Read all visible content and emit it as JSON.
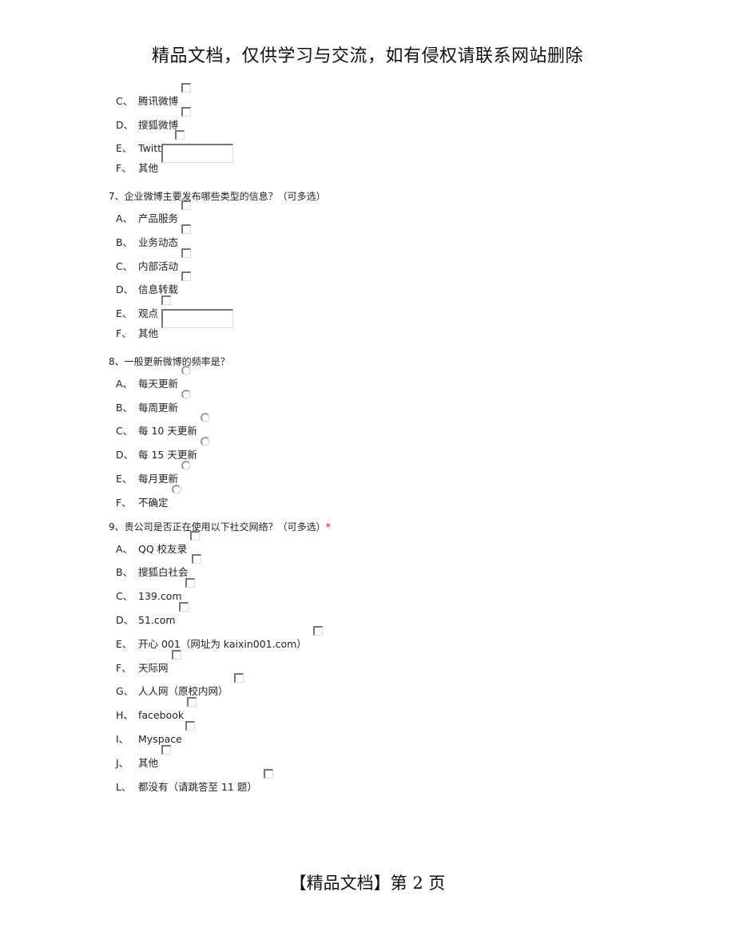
{
  "header": {
    "text": "精品文档，仅供学习与交流，如有侵权请联系网站删除"
  },
  "footer": {
    "text": "【精品文档】第 2 页"
  },
  "q6_tail": {
    "options": [
      {
        "letter": "C、",
        "label": "腾讯微博",
        "control": "checkbox"
      },
      {
        "letter": "D、",
        "label": "搜狐微博",
        "control": "checkbox"
      },
      {
        "letter": "E、",
        "label": "Twitter",
        "control": "checkbox"
      },
      {
        "letter": "F、",
        "label": "其他",
        "control": "text",
        "value": ""
      }
    ]
  },
  "q7": {
    "title": "7、企业微博主要发布哪些类型的信息？（可多选）",
    "options": [
      {
        "letter": "A、",
        "label": "产品服务",
        "control": "checkbox"
      },
      {
        "letter": "B、",
        "label": "业务动态",
        "control": "checkbox"
      },
      {
        "letter": "C、",
        "label": "内部活动",
        "control": "checkbox"
      },
      {
        "letter": "D、",
        "label": "信息转载",
        "control": "checkbox"
      },
      {
        "letter": "E、",
        "label": "观点",
        "control": "checkbox"
      },
      {
        "letter": "F、",
        "label": "其他",
        "control": "text",
        "value": ""
      }
    ]
  },
  "q8": {
    "title": "8、一般更新微博的频率是？",
    "options": [
      {
        "letter": "A、",
        "label": "每天更新",
        "control": "radio"
      },
      {
        "letter": "B、",
        "label": "每周更新",
        "control": "radio"
      },
      {
        "letter": "C、",
        "label": "每 10 天更新",
        "control": "radio"
      },
      {
        "letter": "D、",
        "label": "每 15 天更新",
        "control": "radio"
      },
      {
        "letter": "E、",
        "label": "每月更新",
        "control": "radio"
      },
      {
        "letter": "F、",
        "label": "不确定",
        "control": "radio"
      }
    ]
  },
  "q9": {
    "title": "9、贵公司是否正在使用以下社交网络？（可多选）",
    "required_mark": "*",
    "options": [
      {
        "letter": "A、",
        "label": "QQ 校友录",
        "control": "checkbox"
      },
      {
        "letter": "B、",
        "label": "搜狐白社会",
        "control": "checkbox"
      },
      {
        "letter": "C、",
        "label": "139.com",
        "control": "checkbox"
      },
      {
        "letter": "D、",
        "label": "51.com",
        "control": "checkbox"
      },
      {
        "letter": "E、",
        "label": "开心 001（网址为 kaixin001.com） ",
        "control": "checkbox"
      },
      {
        "letter": "F、",
        "label": "天际网",
        "control": "checkbox"
      },
      {
        "letter": "G、",
        "label": "人人网（原校内网） ",
        "control": "checkbox"
      },
      {
        "letter": "H、",
        "label": "facebook",
        "control": "checkbox"
      },
      {
        "letter": "I、",
        "label": "Myspace",
        "control": "checkbox"
      },
      {
        "letter": "J、",
        "label": "其他",
        "control": "checkbox"
      },
      {
        "letter": "L、",
        "label": "都没有（请跳答至 11 题） ",
        "control": "checkbox"
      }
    ]
  }
}
